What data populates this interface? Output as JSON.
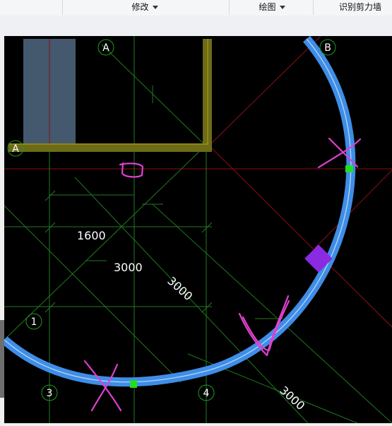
{
  "toolbar": {
    "modify_label": "修改",
    "draw_label": "绘图",
    "recognize_label": "识别剪力墙"
  },
  "axes": {
    "a_top": "A",
    "b_top": "B",
    "a_left": "A",
    "grid_1": "1",
    "grid_3": "3",
    "grid_4": "4"
  },
  "dimensions": {
    "d1600": "1600",
    "d3000_h": "3000",
    "d3000_diag1": "3000",
    "d3000_diag2": "3000"
  },
  "colors": {
    "canvas": "#000000",
    "grid_line": "#1f7a1f",
    "red_line": "#8b1010",
    "arc_wall": "#3f8de6",
    "annotation": "#e040d0",
    "marker_square": "#22dd22",
    "purple_diamond": "#8a2be2",
    "column": "#44586e",
    "beam": "#6b6b1a"
  }
}
